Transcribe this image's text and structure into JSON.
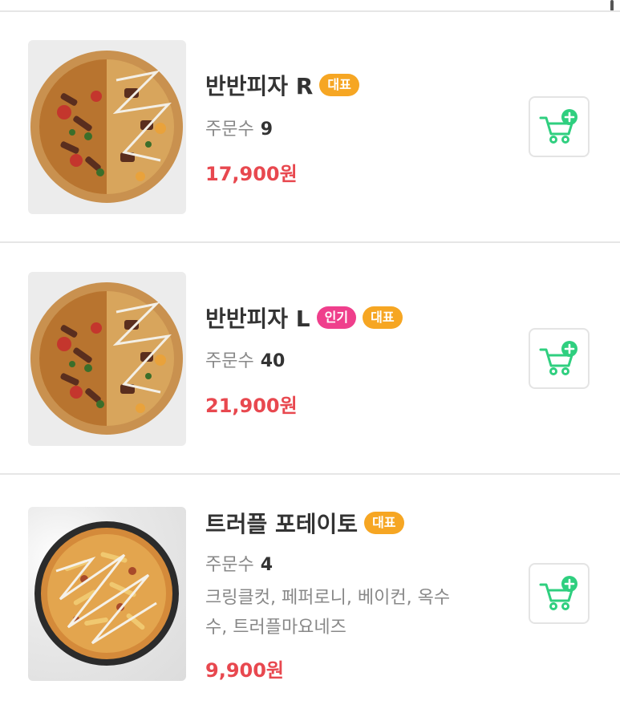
{
  "items": [
    {
      "name": "반반피자 R",
      "badges": [
        "대표"
      ],
      "orders_label": "주문수",
      "orders_count": "9",
      "price": "17,900원",
      "description": ""
    },
    {
      "name": "반반피자 L",
      "badges": [
        "인기",
        "대표"
      ],
      "orders_label": "주문수",
      "orders_count": "40",
      "price": "21,900원",
      "description": ""
    },
    {
      "name": "트러플 포테이토",
      "badges": [
        "대표"
      ],
      "orders_label": "주문수",
      "orders_count": "4",
      "price": "9,900원",
      "description_line1": "크링클컷, 페퍼로니, 베이컨, 옥수",
      "description_line2": "수, 트러플마요네즈"
    }
  ],
  "icons": {
    "cart": "cart-add-icon"
  },
  "colors": {
    "price": "#e8484f",
    "badge_rep": "#f6a623",
    "badge_pop": "#ef3f8c",
    "cart_icon": "#2fcf7f"
  }
}
